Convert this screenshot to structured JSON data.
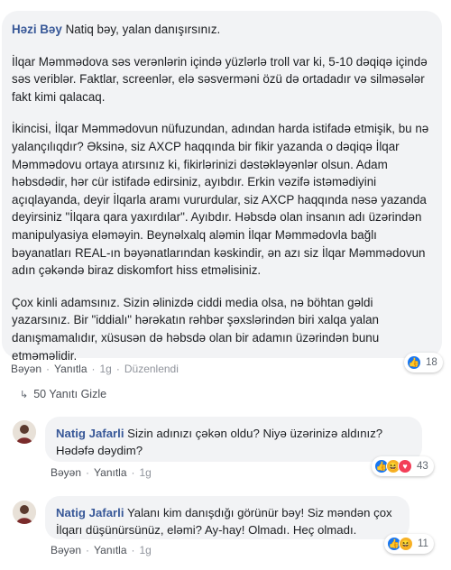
{
  "post_comment": {
    "author": "Həzi Bəy",
    "paragraphs": [
      "Natiq bəy, yalan danışırsınız.",
      "İlqar Məmmədova səs verənlərin içində yüzlərlə troll var ki, 5-10 dəqiqə içində səs veriblər. Faktlar, screenlər, elə səsverməni özü də ortadadır və silməsələr fakt kimi qalacaq.",
      "İkincisi, İlqar Məmmədovun nüfuzundan, adından harda istifadə etmişik, bu nə yalançılıqdır? Əksinə, siz AXCP haqqında bir fikir yazanda o dəqiqə İlqar Məmmədovu ortaya atırsınız ki, fikirlərinizi dəstəkləyənlər olsun. Adam həbsdədir, hər cür istifadə edirsiniz, ayıbdır. Erkin vəzifə istəmədiyini açıqlayanda, deyir İlqarla aramı vururdular, siz AXCP haqqında nəsə yazanda deyirsiniz \"İlqara qara yaxırdılar\". Ayıbdır. Həbsdə olan insanın adı üzərindən manipulyasiya eləməyin. Beynəlxalq aləmin İlqar Məmmədovla bağlı bəyanatları REAL-ın bəyənatlarından kəskindir, ən azı siz İlqar Məmmədovun adın çəkəndə biraz diskomfort hiss etməlisiniz.",
      "Çox kinli adamsınız. Sizin əlinizdə ciddi media olsa, nə böhtan gəldi yazarsınız. Bir \"iddialı\" hərəkatın rəhbər şəxslərindən biri xalqa yalan danışmamalıdır, xüsusən də həbsdə olan bir adamın üzərindən bunu etməməlidir."
    ],
    "actions": {
      "like": "Bəyən",
      "reply": "Yanıtla",
      "time": "1g",
      "edited": "Düzenlendi"
    },
    "reactions": {
      "count": "18",
      "icons": [
        "like-icon"
      ]
    }
  },
  "replies_toggle": {
    "label": "50 Yanıtı Gizle",
    "icon": "reply-arrow-icon"
  },
  "replies": [
    {
      "author": "Natig Jafarli",
      "text": "Sizin adınızı çəkən oldu? Niyə üzərinizə aldınız? Hədəfə dəydim?",
      "actions": {
        "like": "Bəyən",
        "reply": "Yanıtla",
        "time": "1g"
      },
      "reactions": {
        "count": "43",
        "icons": [
          "like-icon",
          "haha-icon",
          "love-icon"
        ]
      }
    },
    {
      "author": "Natig Jafarli",
      "text": "Yalanı kim danışdığı görünür bəy! Siz məndən çox İlqarı düşünürsünüz, eləmi? Ay-hay! Olmadı. Heç olmadı.",
      "actions": {
        "like": "Bəyən",
        "reply": "Yanıtla",
        "time": "1g"
      },
      "reactions": {
        "count": "11",
        "icons": [
          "like-icon",
          "haha-icon"
        ]
      }
    }
  ],
  "colors": {
    "author": "#385898",
    "bubble": "#f2f3f5",
    "like": "#1877f2",
    "haha": "#f7b125",
    "love": "#f33e58"
  }
}
